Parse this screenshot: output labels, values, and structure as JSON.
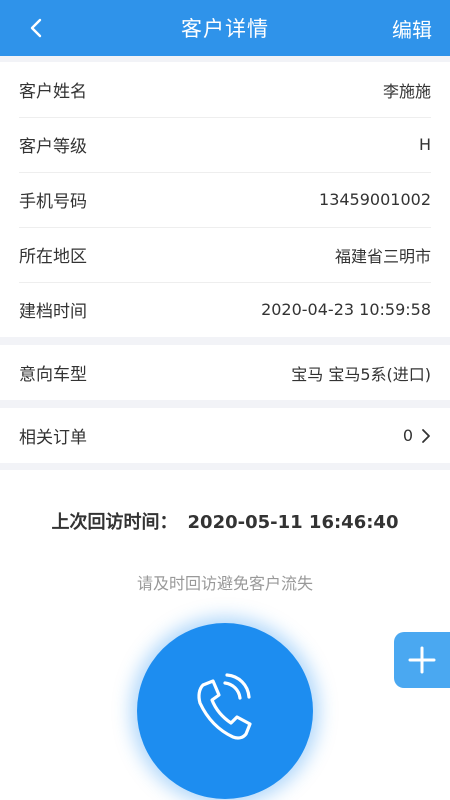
{
  "header": {
    "title": "客户详情",
    "edit_label": "编辑"
  },
  "details": [
    {
      "label": "客户姓名",
      "value": "李施施"
    },
    {
      "label": "客户等级",
      "value": "H"
    },
    {
      "label": "手机号码",
      "value": "13459001002"
    },
    {
      "label": "所在地区",
      "value": "福建省三明市"
    },
    {
      "label": "建档时间",
      "value": "2020-04-23 10:59:58"
    }
  ],
  "intent": {
    "label": "意向车型",
    "value": "宝马 宝马5系(进口)"
  },
  "orders": {
    "label": "相关订单",
    "value": "0"
  },
  "visit": {
    "label": "上次回访时间：",
    "time": "2020-05-11 16:46:40",
    "hint": "请及时回访避免客户流失"
  },
  "colors": {
    "header": "#2f93ea",
    "call_button": "#1d8df0",
    "add_button": "#4aa8f1"
  },
  "icons": {
    "back": "chevron-left-icon",
    "chevron": "chevron-right-icon",
    "phone": "phone-icon",
    "add": "plus-icon"
  }
}
